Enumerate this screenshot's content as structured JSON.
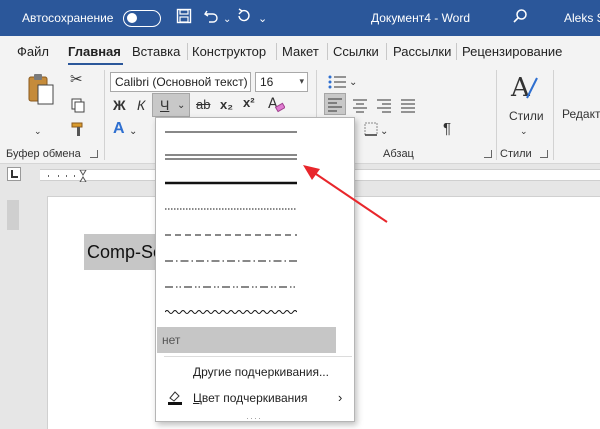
{
  "titlebar": {
    "autosave_label": "Автосохранение",
    "doc_title": "Документ4  -  Word",
    "user": "Aleks S"
  },
  "tabs": [
    {
      "label": "Файл"
    },
    {
      "label": "Главная"
    },
    {
      "label": "Вставка"
    },
    {
      "label": "Конструктор"
    },
    {
      "label": "Макет"
    },
    {
      "label": "Ссылки"
    },
    {
      "label": "Рассылки"
    },
    {
      "label": "Рецензирование"
    }
  ],
  "ribbon": {
    "clipboard_label": "Буфер обмена",
    "font_name": "Calibri (Основной текст)",
    "font_size": "16",
    "bold": "Ж",
    "italic": "К",
    "underline": "Ч",
    "strike": "ab",
    "subscript": "x₂",
    "superscript": "x²",
    "paragraph_label": "Абзац",
    "styles_label": "Стили",
    "styles_button": "Стили",
    "edit_label": "Редакт"
  },
  "document": {
    "text": "Comp-Service"
  },
  "underline_menu": {
    "none_label": "нет",
    "more_label": "Другие подчеркивания...",
    "color_label_prefix": "Ц",
    "color_label_rest": "вет подчеркивания"
  },
  "colors": {
    "titlebar": "#2b579a",
    "ribbon": "#f3f3f3",
    "arrow": "#e8262b"
  }
}
